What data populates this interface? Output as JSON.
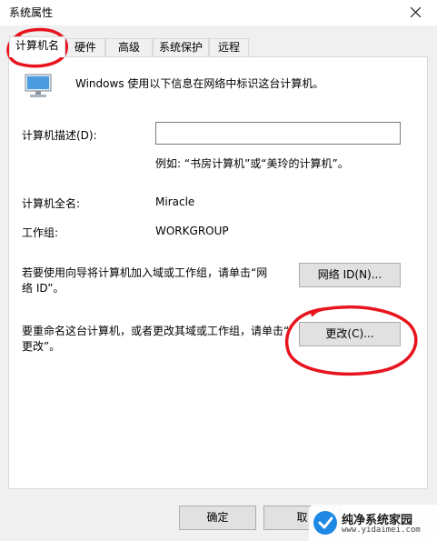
{
  "window": {
    "title": "系统属性",
    "close_icon": "close-icon"
  },
  "tabs": [
    {
      "label": "计算机名",
      "active": true
    },
    {
      "label": "硬件",
      "active": false
    },
    {
      "label": "高级",
      "active": false
    },
    {
      "label": "系统保护",
      "active": false
    },
    {
      "label": "远程",
      "active": false
    }
  ],
  "intro": {
    "icon": "computer-icon",
    "text": "Windows 使用以下信息在网络中标识这台计算机。"
  },
  "description": {
    "label": "计算机描述(D):",
    "value": "",
    "example": "例如: “书房计算机”或“美玲的计算机”。"
  },
  "full_name": {
    "label": "计算机全名:",
    "value": "Miracle"
  },
  "workgroup": {
    "label": "工作组:",
    "value": "WORKGROUP"
  },
  "network_id": {
    "text_line1": "若要使用向导将计算机加入域或工作组，请单击“网",
    "text_line2": "络 ID”。",
    "button": "网络 ID(N)..."
  },
  "rename": {
    "text_line1": "要重命名这台计算机，或者更改其域或工作组，请单击“",
    "text_line2": "更改”。",
    "button": "更改(C)..."
  },
  "footer": {
    "ok_button": "确定",
    "cancel_button": "取"
  },
  "watermark": {
    "name": "纯净系统家园",
    "url": "www.yidaimei.com"
  },
  "colors": {
    "annotation_red": "#e8141e",
    "focus_blue": "#0078d7"
  }
}
